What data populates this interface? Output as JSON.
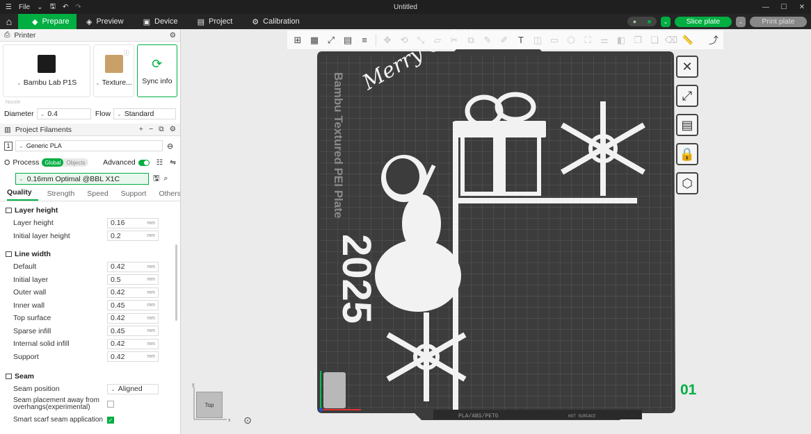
{
  "titlebar": {
    "file_label": "File",
    "window_title": "Untitled"
  },
  "tabs": [
    {
      "label": "Prepare",
      "icon": "prepare-icon"
    },
    {
      "label": "Preview",
      "icon": "preview-icon"
    },
    {
      "label": "Device",
      "icon": "device-icon"
    },
    {
      "label": "Project",
      "icon": "project-icon"
    },
    {
      "label": "Calibration",
      "icon": "calibration-icon"
    }
  ],
  "actions": {
    "slice_label": "Slice plate",
    "print_label": "Print plate"
  },
  "printer": {
    "section_title": "Printer",
    "printer_name": "Bambu Lab P1S",
    "plate_name": "Texture...",
    "sync_label": "Sync info",
    "nozzle_label": "Nozzle",
    "diameter_label": "Diameter",
    "diameter_value": "0.4",
    "flow_label": "Flow",
    "flow_value": "Standard"
  },
  "filaments": {
    "section_title": "Project Filaments",
    "items": [
      {
        "index": "1",
        "name": "Generic PLA"
      }
    ]
  },
  "process": {
    "section_title": "Process",
    "scope_global": "Global",
    "scope_objects": "Objects",
    "advanced_label": "Advanced",
    "preset": "0.16mm Optimal @BBL X1C",
    "tabs": [
      "Quality",
      "Strength",
      "Speed",
      "Support",
      "Others"
    ],
    "unit": "mm",
    "layer_height": {
      "title": "Layer height",
      "rows": [
        {
          "label": "Layer height",
          "value": "0.16"
        },
        {
          "label": "Initial layer height",
          "value": "0.2"
        }
      ]
    },
    "line_width": {
      "title": "Line width",
      "rows": [
        {
          "label": "Default",
          "value": "0.42"
        },
        {
          "label": "Initial layer",
          "value": "0.5"
        },
        {
          "label": "Outer wall",
          "value": "0.42"
        },
        {
          "label": "Inner wall",
          "value": "0.45"
        },
        {
          "label": "Top surface",
          "value": "0.42"
        },
        {
          "label": "Sparse infill",
          "value": "0.45"
        },
        {
          "label": "Internal solid infill",
          "value": "0.42"
        },
        {
          "label": "Support",
          "value": "0.42"
        }
      ]
    },
    "seam": {
      "title": "Seam",
      "position_label": "Seam position",
      "position_value": "Aligned",
      "away_label": "Seam placement away from overhangs(experimental)",
      "away_checked": false,
      "scarf_label": "Smart scarf seam application",
      "scarf_checked": true
    }
  },
  "plate": {
    "bed_label": "Bambu Textured PEI Plate",
    "filament_label": "PLA/ABS/PETG",
    "surface_label": "HOT SURFACE",
    "plate_number": "01",
    "model_title_text": "Merry Christmas",
    "model_year_text": "2025",
    "viewcube_label": "Top"
  },
  "colors": {
    "accent": "#00ae42",
    "bed": "#3c3c3c",
    "model": "#f2f2f2"
  }
}
